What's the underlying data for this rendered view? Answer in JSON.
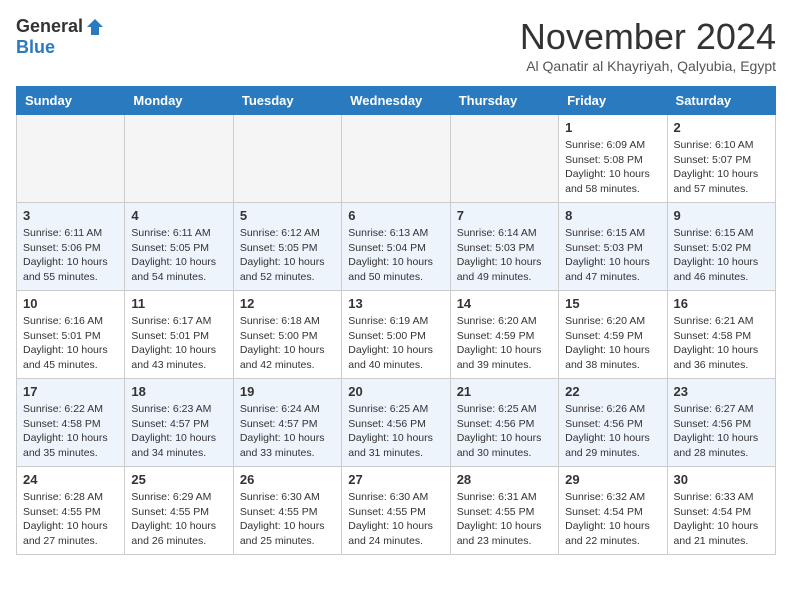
{
  "header": {
    "logo_general": "General",
    "logo_blue": "Blue",
    "month_title": "November 2024",
    "location": "Al Qanatir al Khayriyah, Qalyubia, Egypt"
  },
  "weekdays": [
    "Sunday",
    "Monday",
    "Tuesday",
    "Wednesday",
    "Thursday",
    "Friday",
    "Saturday"
  ],
  "weeks": [
    {
      "alt": false,
      "days": [
        {
          "day": "",
          "empty": true
        },
        {
          "day": "",
          "empty": true
        },
        {
          "day": "",
          "empty": true
        },
        {
          "day": "",
          "empty": true
        },
        {
          "day": "",
          "empty": true
        },
        {
          "day": "1",
          "empty": false,
          "sunrise": "6:09 AM",
          "sunset": "5:08 PM",
          "daylight": "10 hours and 58 minutes."
        },
        {
          "day": "2",
          "empty": false,
          "sunrise": "6:10 AM",
          "sunset": "5:07 PM",
          "daylight": "10 hours and 57 minutes."
        }
      ]
    },
    {
      "alt": true,
      "days": [
        {
          "day": "3",
          "empty": false,
          "sunrise": "6:11 AM",
          "sunset": "5:06 PM",
          "daylight": "10 hours and 55 minutes."
        },
        {
          "day": "4",
          "empty": false,
          "sunrise": "6:11 AM",
          "sunset": "5:05 PM",
          "daylight": "10 hours and 54 minutes."
        },
        {
          "day": "5",
          "empty": false,
          "sunrise": "6:12 AM",
          "sunset": "5:05 PM",
          "daylight": "10 hours and 52 minutes."
        },
        {
          "day": "6",
          "empty": false,
          "sunrise": "6:13 AM",
          "sunset": "5:04 PM",
          "daylight": "10 hours and 50 minutes."
        },
        {
          "day": "7",
          "empty": false,
          "sunrise": "6:14 AM",
          "sunset": "5:03 PM",
          "daylight": "10 hours and 49 minutes."
        },
        {
          "day": "8",
          "empty": false,
          "sunrise": "6:15 AM",
          "sunset": "5:03 PM",
          "daylight": "10 hours and 47 minutes."
        },
        {
          "day": "9",
          "empty": false,
          "sunrise": "6:15 AM",
          "sunset": "5:02 PM",
          "daylight": "10 hours and 46 minutes."
        }
      ]
    },
    {
      "alt": false,
      "days": [
        {
          "day": "10",
          "empty": false,
          "sunrise": "6:16 AM",
          "sunset": "5:01 PM",
          "daylight": "10 hours and 45 minutes."
        },
        {
          "day": "11",
          "empty": false,
          "sunrise": "6:17 AM",
          "sunset": "5:01 PM",
          "daylight": "10 hours and 43 minutes."
        },
        {
          "day": "12",
          "empty": false,
          "sunrise": "6:18 AM",
          "sunset": "5:00 PM",
          "daylight": "10 hours and 42 minutes."
        },
        {
          "day": "13",
          "empty": false,
          "sunrise": "6:19 AM",
          "sunset": "5:00 PM",
          "daylight": "10 hours and 40 minutes."
        },
        {
          "day": "14",
          "empty": false,
          "sunrise": "6:20 AM",
          "sunset": "4:59 PM",
          "daylight": "10 hours and 39 minutes."
        },
        {
          "day": "15",
          "empty": false,
          "sunrise": "6:20 AM",
          "sunset": "4:59 PM",
          "daylight": "10 hours and 38 minutes."
        },
        {
          "day": "16",
          "empty": false,
          "sunrise": "6:21 AM",
          "sunset": "4:58 PM",
          "daylight": "10 hours and 36 minutes."
        }
      ]
    },
    {
      "alt": true,
      "days": [
        {
          "day": "17",
          "empty": false,
          "sunrise": "6:22 AM",
          "sunset": "4:58 PM",
          "daylight": "10 hours and 35 minutes."
        },
        {
          "day": "18",
          "empty": false,
          "sunrise": "6:23 AM",
          "sunset": "4:57 PM",
          "daylight": "10 hours and 34 minutes."
        },
        {
          "day": "19",
          "empty": false,
          "sunrise": "6:24 AM",
          "sunset": "4:57 PM",
          "daylight": "10 hours and 33 minutes."
        },
        {
          "day": "20",
          "empty": false,
          "sunrise": "6:25 AM",
          "sunset": "4:56 PM",
          "daylight": "10 hours and 31 minutes."
        },
        {
          "day": "21",
          "empty": false,
          "sunrise": "6:25 AM",
          "sunset": "4:56 PM",
          "daylight": "10 hours and 30 minutes."
        },
        {
          "day": "22",
          "empty": false,
          "sunrise": "6:26 AM",
          "sunset": "4:56 PM",
          "daylight": "10 hours and 29 minutes."
        },
        {
          "day": "23",
          "empty": false,
          "sunrise": "6:27 AM",
          "sunset": "4:56 PM",
          "daylight": "10 hours and 28 minutes."
        }
      ]
    },
    {
      "alt": false,
      "days": [
        {
          "day": "24",
          "empty": false,
          "sunrise": "6:28 AM",
          "sunset": "4:55 PM",
          "daylight": "10 hours and 27 minutes."
        },
        {
          "day": "25",
          "empty": false,
          "sunrise": "6:29 AM",
          "sunset": "4:55 PM",
          "daylight": "10 hours and 26 minutes."
        },
        {
          "day": "26",
          "empty": false,
          "sunrise": "6:30 AM",
          "sunset": "4:55 PM",
          "daylight": "10 hours and 25 minutes."
        },
        {
          "day": "27",
          "empty": false,
          "sunrise": "6:30 AM",
          "sunset": "4:55 PM",
          "daylight": "10 hours and 24 minutes."
        },
        {
          "day": "28",
          "empty": false,
          "sunrise": "6:31 AM",
          "sunset": "4:55 PM",
          "daylight": "10 hours and 23 minutes."
        },
        {
          "day": "29",
          "empty": false,
          "sunrise": "6:32 AM",
          "sunset": "4:54 PM",
          "daylight": "10 hours and 22 minutes."
        },
        {
          "day": "30",
          "empty": false,
          "sunrise": "6:33 AM",
          "sunset": "4:54 PM",
          "daylight": "10 hours and 21 minutes."
        }
      ]
    }
  ]
}
